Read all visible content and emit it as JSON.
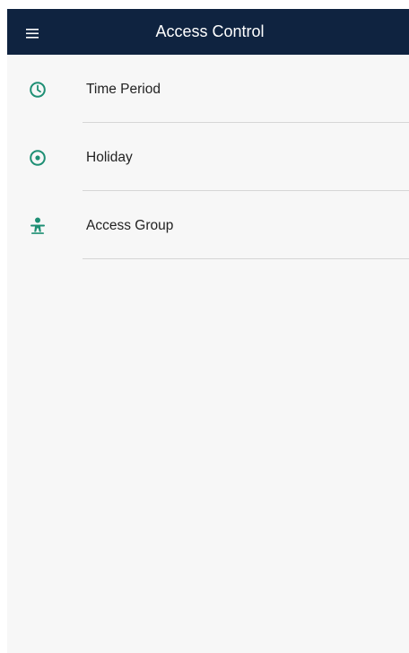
{
  "header": {
    "title": "Access Control",
    "background_color": "#0f2340",
    "menu_icon": "hamburger-menu-icon"
  },
  "accent_color": "#1e8f74",
  "menu": {
    "items": [
      {
        "label": "Time Period",
        "icon": "clock-icon"
      },
      {
        "label": "Holiday",
        "icon": "radio-target-icon"
      },
      {
        "label": "Access Group",
        "icon": "person-group-icon"
      }
    ]
  }
}
